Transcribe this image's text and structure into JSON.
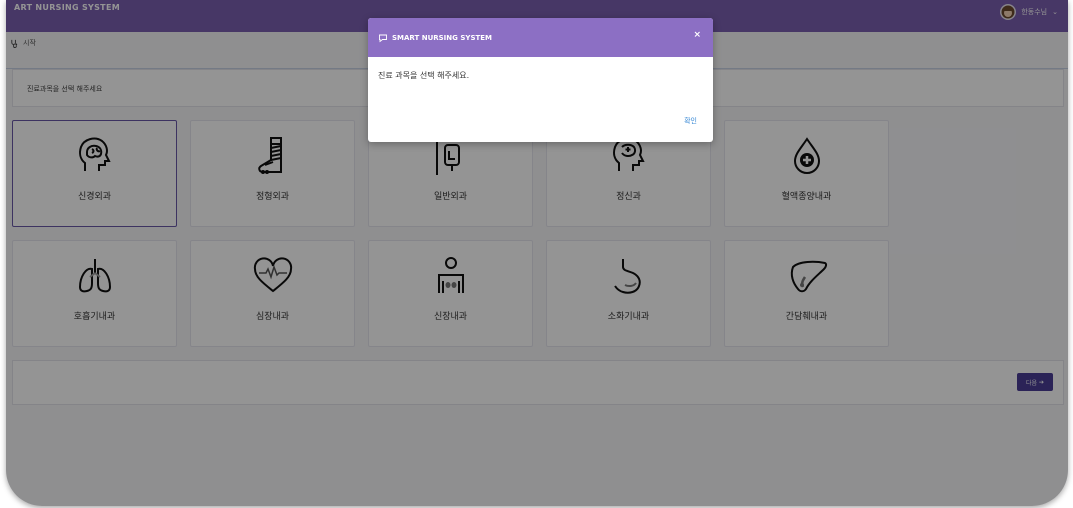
{
  "app": {
    "title": "ART NURSING SYSTEM",
    "user_name": "한동수님"
  },
  "breadcrumb": {
    "label": "시작"
  },
  "select_prompt": "진료과목을 선택 해주세요",
  "departments": [
    {
      "label": "신경외과",
      "icon": "brain-head-icon",
      "selected": true
    },
    {
      "label": "정형외과",
      "icon": "leg-cast-icon",
      "selected": false
    },
    {
      "label": "일반외과",
      "icon": "iv-drip-icon",
      "selected": false
    },
    {
      "label": "정신과",
      "icon": "mental-head-icon",
      "selected": false
    },
    {
      "label": "혈액종양내과",
      "icon": "blood-drop-icon",
      "selected": false
    },
    {
      "label": "호흡기내과",
      "icon": "lungs-icon",
      "selected": false
    },
    {
      "label": "심장내과",
      "icon": "heart-pulse-icon",
      "selected": false
    },
    {
      "label": "신장내과",
      "icon": "kidney-person-icon",
      "selected": false
    },
    {
      "label": "소화기내과",
      "icon": "stomach-icon",
      "selected": false
    },
    {
      "label": "간담췌내과",
      "icon": "liver-icon",
      "selected": false
    }
  ],
  "footer": {
    "next_label": "다음"
  },
  "modal": {
    "title": "SMART NURSING SYSTEM",
    "close": "×",
    "message": "진료 과목을 선택 해주세요.",
    "ok_label": "확인"
  },
  "colors": {
    "header": "#7b5fb0",
    "modal_header": "#8c6fc4",
    "accent": "#4a3d96",
    "link": "#3a8ad6"
  }
}
